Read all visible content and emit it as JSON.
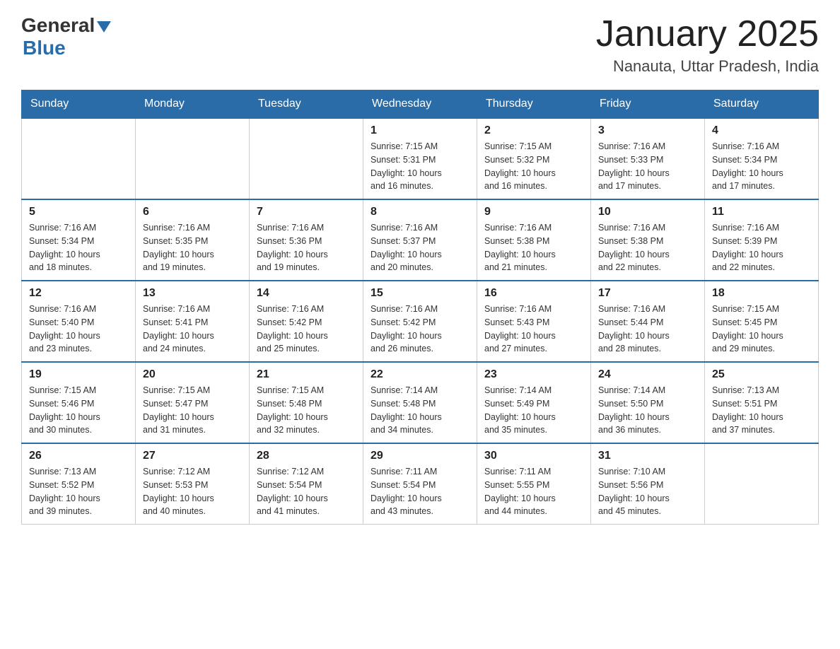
{
  "header": {
    "logo": {
      "general": "General",
      "blue": "Blue"
    },
    "title": "January 2025",
    "location": "Nanauta, Uttar Pradesh, India"
  },
  "weekdays": [
    "Sunday",
    "Monday",
    "Tuesday",
    "Wednesday",
    "Thursday",
    "Friday",
    "Saturday"
  ],
  "weeks": [
    [
      {
        "day": "",
        "info": ""
      },
      {
        "day": "",
        "info": ""
      },
      {
        "day": "",
        "info": ""
      },
      {
        "day": "1",
        "info": "Sunrise: 7:15 AM\nSunset: 5:31 PM\nDaylight: 10 hours\nand 16 minutes."
      },
      {
        "day": "2",
        "info": "Sunrise: 7:15 AM\nSunset: 5:32 PM\nDaylight: 10 hours\nand 16 minutes."
      },
      {
        "day": "3",
        "info": "Sunrise: 7:16 AM\nSunset: 5:33 PM\nDaylight: 10 hours\nand 17 minutes."
      },
      {
        "day": "4",
        "info": "Sunrise: 7:16 AM\nSunset: 5:34 PM\nDaylight: 10 hours\nand 17 minutes."
      }
    ],
    [
      {
        "day": "5",
        "info": "Sunrise: 7:16 AM\nSunset: 5:34 PM\nDaylight: 10 hours\nand 18 minutes."
      },
      {
        "day": "6",
        "info": "Sunrise: 7:16 AM\nSunset: 5:35 PM\nDaylight: 10 hours\nand 19 minutes."
      },
      {
        "day": "7",
        "info": "Sunrise: 7:16 AM\nSunset: 5:36 PM\nDaylight: 10 hours\nand 19 minutes."
      },
      {
        "day": "8",
        "info": "Sunrise: 7:16 AM\nSunset: 5:37 PM\nDaylight: 10 hours\nand 20 minutes."
      },
      {
        "day": "9",
        "info": "Sunrise: 7:16 AM\nSunset: 5:38 PM\nDaylight: 10 hours\nand 21 minutes."
      },
      {
        "day": "10",
        "info": "Sunrise: 7:16 AM\nSunset: 5:38 PM\nDaylight: 10 hours\nand 22 minutes."
      },
      {
        "day": "11",
        "info": "Sunrise: 7:16 AM\nSunset: 5:39 PM\nDaylight: 10 hours\nand 22 minutes."
      }
    ],
    [
      {
        "day": "12",
        "info": "Sunrise: 7:16 AM\nSunset: 5:40 PM\nDaylight: 10 hours\nand 23 minutes."
      },
      {
        "day": "13",
        "info": "Sunrise: 7:16 AM\nSunset: 5:41 PM\nDaylight: 10 hours\nand 24 minutes."
      },
      {
        "day": "14",
        "info": "Sunrise: 7:16 AM\nSunset: 5:42 PM\nDaylight: 10 hours\nand 25 minutes."
      },
      {
        "day": "15",
        "info": "Sunrise: 7:16 AM\nSunset: 5:42 PM\nDaylight: 10 hours\nand 26 minutes."
      },
      {
        "day": "16",
        "info": "Sunrise: 7:16 AM\nSunset: 5:43 PM\nDaylight: 10 hours\nand 27 minutes."
      },
      {
        "day": "17",
        "info": "Sunrise: 7:16 AM\nSunset: 5:44 PM\nDaylight: 10 hours\nand 28 minutes."
      },
      {
        "day": "18",
        "info": "Sunrise: 7:15 AM\nSunset: 5:45 PM\nDaylight: 10 hours\nand 29 minutes."
      }
    ],
    [
      {
        "day": "19",
        "info": "Sunrise: 7:15 AM\nSunset: 5:46 PM\nDaylight: 10 hours\nand 30 minutes."
      },
      {
        "day": "20",
        "info": "Sunrise: 7:15 AM\nSunset: 5:47 PM\nDaylight: 10 hours\nand 31 minutes."
      },
      {
        "day": "21",
        "info": "Sunrise: 7:15 AM\nSunset: 5:48 PM\nDaylight: 10 hours\nand 32 minutes."
      },
      {
        "day": "22",
        "info": "Sunrise: 7:14 AM\nSunset: 5:48 PM\nDaylight: 10 hours\nand 34 minutes."
      },
      {
        "day": "23",
        "info": "Sunrise: 7:14 AM\nSunset: 5:49 PM\nDaylight: 10 hours\nand 35 minutes."
      },
      {
        "day": "24",
        "info": "Sunrise: 7:14 AM\nSunset: 5:50 PM\nDaylight: 10 hours\nand 36 minutes."
      },
      {
        "day": "25",
        "info": "Sunrise: 7:13 AM\nSunset: 5:51 PM\nDaylight: 10 hours\nand 37 minutes."
      }
    ],
    [
      {
        "day": "26",
        "info": "Sunrise: 7:13 AM\nSunset: 5:52 PM\nDaylight: 10 hours\nand 39 minutes."
      },
      {
        "day": "27",
        "info": "Sunrise: 7:12 AM\nSunset: 5:53 PM\nDaylight: 10 hours\nand 40 minutes."
      },
      {
        "day": "28",
        "info": "Sunrise: 7:12 AM\nSunset: 5:54 PM\nDaylight: 10 hours\nand 41 minutes."
      },
      {
        "day": "29",
        "info": "Sunrise: 7:11 AM\nSunset: 5:54 PM\nDaylight: 10 hours\nand 43 minutes."
      },
      {
        "day": "30",
        "info": "Sunrise: 7:11 AM\nSunset: 5:55 PM\nDaylight: 10 hours\nand 44 minutes."
      },
      {
        "day": "31",
        "info": "Sunrise: 7:10 AM\nSunset: 5:56 PM\nDaylight: 10 hours\nand 45 minutes."
      },
      {
        "day": "",
        "info": ""
      }
    ]
  ]
}
